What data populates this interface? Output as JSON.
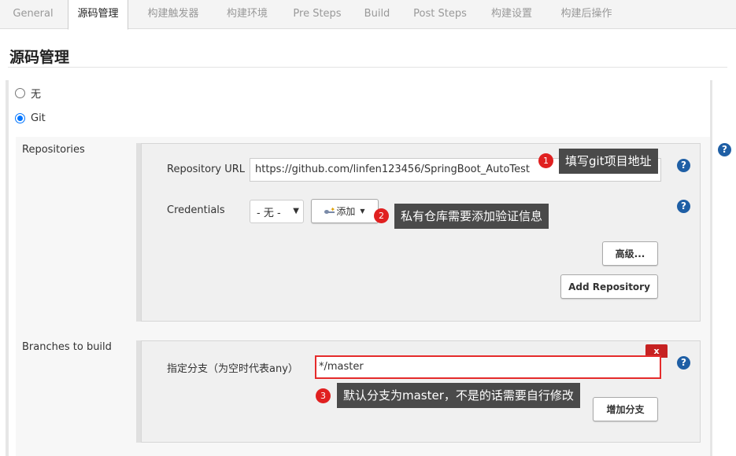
{
  "tabs": [
    {
      "label": "General",
      "active": false
    },
    {
      "label": "源码管理",
      "active": true
    },
    {
      "label": "构建触发器",
      "active": false
    },
    {
      "label": "构建环境",
      "active": false
    },
    {
      "label": "Pre Steps",
      "active": false
    },
    {
      "label": "Build",
      "active": false
    },
    {
      "label": "Post Steps",
      "active": false
    },
    {
      "label": "构建设置",
      "active": false
    },
    {
      "label": "构建后操作",
      "active": false
    }
  ],
  "section_title": "源码管理",
  "scm_options": [
    {
      "label": "无",
      "checked": false
    },
    {
      "label": "Git",
      "checked": true
    }
  ],
  "repositories": {
    "label": "Repositories",
    "url_label": "Repository URL",
    "url_value": "https://github.com/linfen123456/SpringBoot_AutoTest",
    "credentials_label": "Credentials",
    "credentials_value": "- 无 -",
    "add_button": "添加",
    "advanced_button": "高级...",
    "add_repository_button": "Add Repository"
  },
  "branches": {
    "label": "Branches to build",
    "spec_label": "指定分支（为空时代表any）",
    "spec_value": "*/master",
    "delete_label": "x",
    "add_branch_button": "增加分支"
  },
  "annotations": [
    {
      "number": "1",
      "text": "填写git项目地址"
    },
    {
      "number": "2",
      "text": "私有仓库需要添加验证信息"
    },
    {
      "number": "3",
      "text": "默认分支为master，不是的话需要自行修改"
    }
  ],
  "help_glyph": "?",
  "colors": {
    "help": "#1f5fa5",
    "badge": "#e02020",
    "tooltip": "#4a4a4a",
    "highlight": "#e52b2b"
  }
}
